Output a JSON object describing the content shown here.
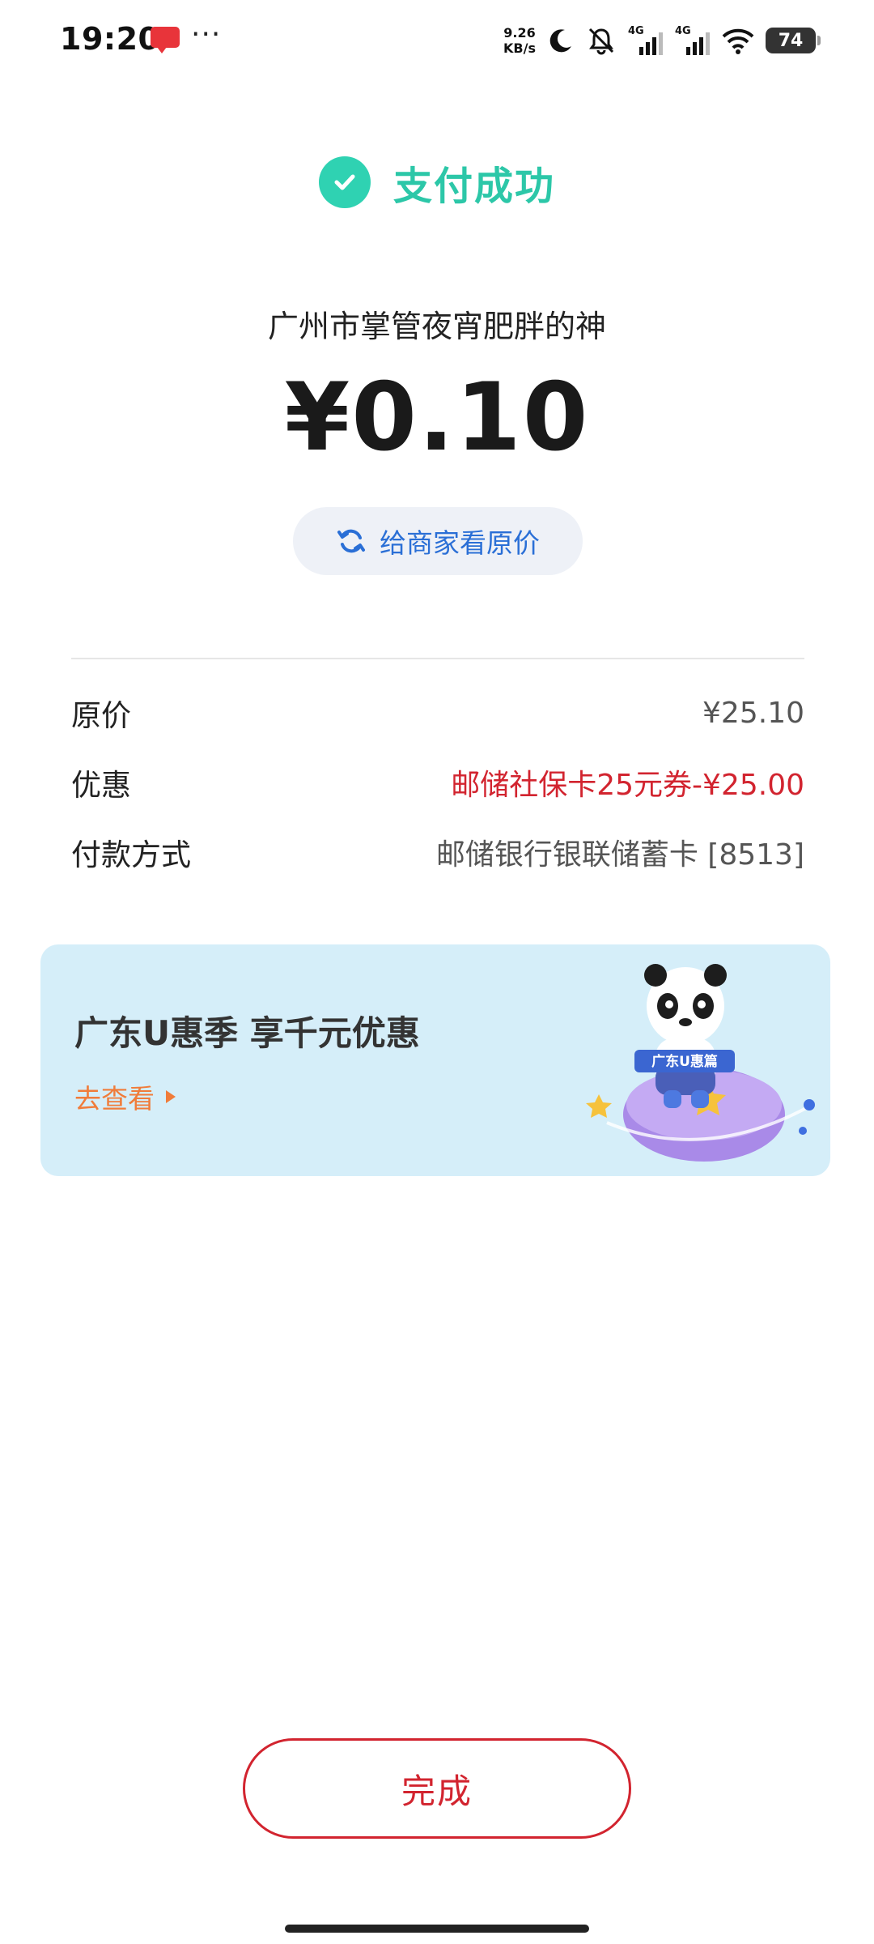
{
  "status_bar": {
    "time": "19:20",
    "more": "···",
    "net_speed_value": "9.26",
    "net_speed_unit": "KB/s",
    "signal1_label": "4G",
    "signal2_label": "4G",
    "battery": "74"
  },
  "result": {
    "success_text": "支付成功",
    "merchant": "广州市掌管夜宵肥胖的神",
    "amount": "¥0.10",
    "show_original_label": "给商家看原价"
  },
  "details": [
    {
      "label": "原价",
      "value": "¥25.10"
    },
    {
      "label": "优惠",
      "value": "邮储社保卡25元券-¥25.00"
    },
    {
      "label": "付款方式",
      "value": "邮储银行银联储蓄卡 [8513]"
    }
  ],
  "promo": {
    "title": "广东U惠季 享千元优惠",
    "link_label": "去查看",
    "mascot_banner": "广东U惠篇"
  },
  "footer": {
    "done_label": "完成"
  },
  "colors": {
    "success": "#2cc7a8",
    "accent_red": "#d2242f",
    "link_blue": "#2a6fd6",
    "promo_bg": "#d5eef9",
    "promo_link": "#f07c3a"
  }
}
